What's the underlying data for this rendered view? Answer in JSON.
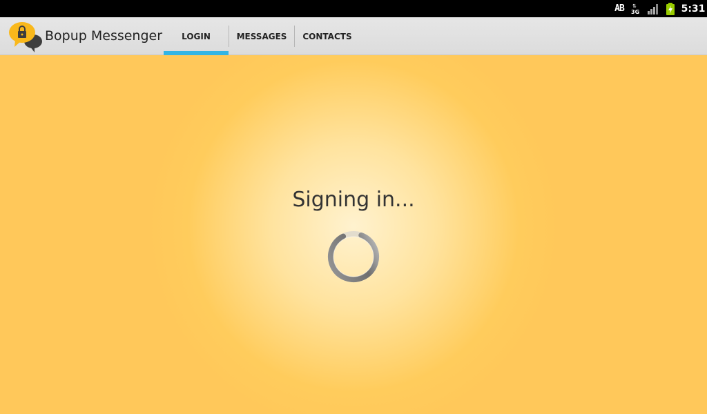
{
  "status_bar": {
    "keyboard_badge": "AB",
    "icons": [
      "network-3g-icon",
      "signal-icon",
      "battery-charging-icon"
    ],
    "time": "5:31"
  },
  "app": {
    "title": "Bopup Messenger",
    "logo_icon": "lock-chat-bubble-icon"
  },
  "tabs": [
    {
      "label": "LOGIN",
      "selected": true
    },
    {
      "label": "MESSAGES",
      "selected": false
    },
    {
      "label": "CONTACTS",
      "selected": false
    }
  ],
  "main": {
    "status_text": "Signing in...",
    "spinner_icon": "loading-spinner-icon"
  },
  "colors": {
    "accent": "#33b5e5",
    "background": "#ffcc5c",
    "background_center": "#fff2cf"
  }
}
